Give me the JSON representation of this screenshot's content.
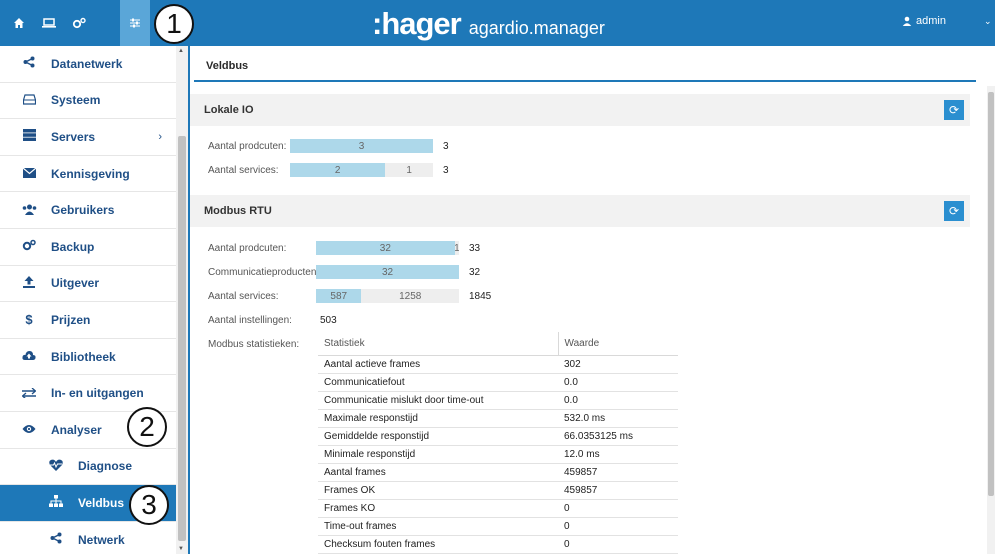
{
  "header": {
    "brand_logo": ":hager",
    "brand_product": "agardio.manager",
    "user_label": "admin",
    "callout": "1"
  },
  "sidebar": {
    "items": [
      {
        "label": "Datanetwerk",
        "icon": "share-icon"
      },
      {
        "label": "Systeem",
        "icon": "drive-icon"
      },
      {
        "label": "Servers",
        "icon": "server-icon",
        "chevron": "›"
      },
      {
        "label": "Kennisgeving",
        "icon": "envelope-icon"
      },
      {
        "label": "Gebruikers",
        "icon": "users-icon"
      },
      {
        "label": "Backup",
        "icon": "cogs-icon"
      },
      {
        "label": "Uitgever",
        "icon": "upload-icon"
      },
      {
        "label": "Prijzen",
        "icon": "dollar-icon"
      },
      {
        "label": "Bibliotheek",
        "icon": "cloud-upload-icon"
      },
      {
        "label": "In- en uitgangen",
        "icon": "exchange-icon"
      },
      {
        "label": "Analyser",
        "icon": "eye-icon"
      },
      {
        "label": "Diagnose",
        "icon": "heartbeat-icon"
      },
      {
        "label": "Veldbus",
        "icon": "sitemap-icon"
      },
      {
        "label": "Netwerk",
        "icon": "share-icon"
      }
    ],
    "callout_analyser": "2",
    "callout_veldbus": "3"
  },
  "main": {
    "tab": "Veldbus",
    "lokale_io": {
      "title": "Lokale IO",
      "producten_label": "Aantal prodcuten:",
      "producten_seg1": "3",
      "producten_fill": 1.0,
      "producten_total": "3",
      "services_label": "Aantal services:",
      "services_seg1": "2",
      "services_seg2": "1",
      "services_fill": 0.667,
      "services_total": "3"
    },
    "modbus": {
      "title": "Modbus RTU",
      "producten_label": "Aantal prodcuten:",
      "producten_seg1": "32",
      "producten_seg2": "1",
      "producten_fill": 0.97,
      "producten_total": "33",
      "comm_label": "Communicatieproducten:",
      "comm_seg1": "32",
      "comm_fill": 1.0,
      "comm_total": "32",
      "services_label": "Aantal services:",
      "services_seg1": "587",
      "services_seg2": "1258",
      "services_fill": 0.318,
      "services_total": "1845",
      "instellingen_label": "Aantal instellingen:",
      "instellingen_value": "503",
      "statistieken_label": "Modbus statistieken:"
    },
    "stats": {
      "col1": "Statistiek",
      "col2": "Waarde",
      "rows": [
        {
          "k": "Aantal actieve frames",
          "v": "302"
        },
        {
          "k": "Communicatiefout",
          "v": "0.0"
        },
        {
          "k": "Communicatie mislukt door time-out",
          "v": "0.0"
        },
        {
          "k": "Maximale responstijd",
          "v": "532.0 ms"
        },
        {
          "k": "Gemiddelde responstijd",
          "v": "66.0353125 ms"
        },
        {
          "k": "Minimale responstijd",
          "v": "12.0 ms"
        },
        {
          "k": "Aantal frames",
          "v": "459857"
        },
        {
          "k": "Frames OK",
          "v": "459857"
        },
        {
          "k": "Frames KO",
          "v": "0"
        },
        {
          "k": "Time-out frames",
          "v": "0"
        },
        {
          "k": "Checksum fouten frames",
          "v": "0"
        }
      ]
    }
  },
  "colors": {
    "accent": "#1e78b8",
    "bar_fill": "#add8ea",
    "active_item": "#1e78b8"
  }
}
